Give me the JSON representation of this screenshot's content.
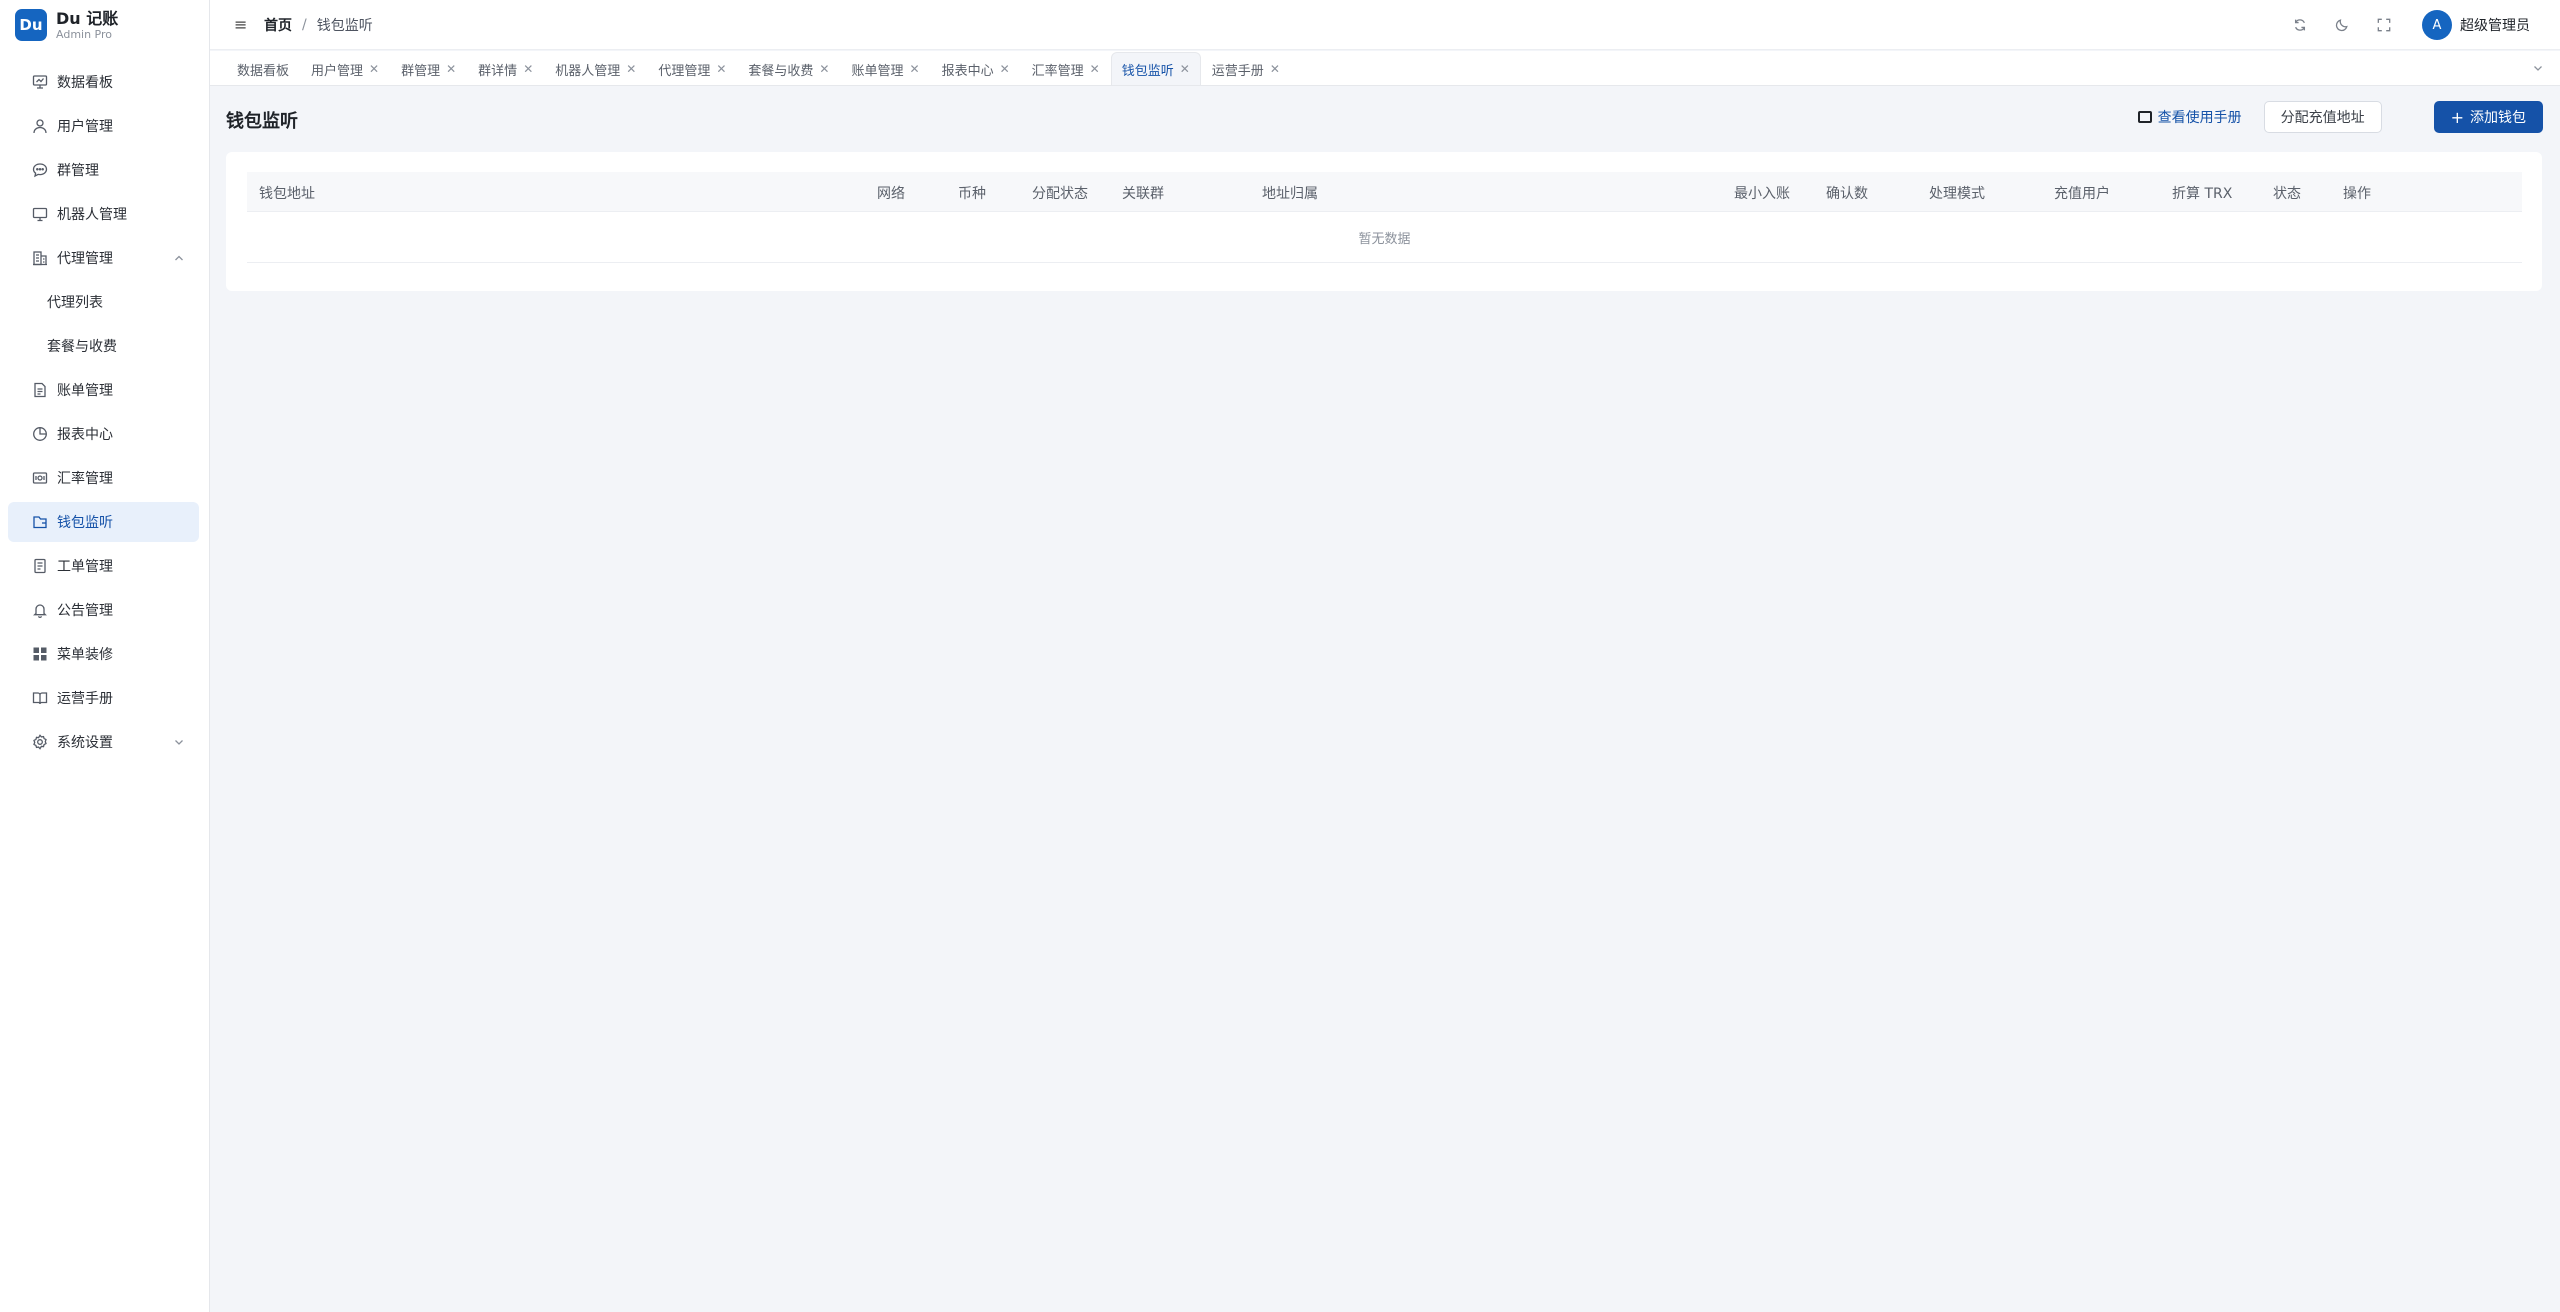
{
  "brand": {
    "logo": "Du",
    "name": "Du 记账",
    "sub": "Admin Pro"
  },
  "sidebar": {
    "items": [
      {
        "label": "数据看板",
        "icon": "dashboard-icon"
      },
      {
        "label": "用户管理",
        "icon": "user-icon"
      },
      {
        "label": "群管理",
        "icon": "chat-icon"
      },
      {
        "label": "机器人管理",
        "icon": "monitor-icon"
      },
      {
        "label": "代理管理",
        "icon": "building-icon",
        "expanded": true
      },
      {
        "label": "代理列表",
        "sub": true
      },
      {
        "label": "套餐与收费",
        "sub": true
      },
      {
        "label": "账单管理",
        "icon": "document-icon"
      },
      {
        "label": "报表中心",
        "icon": "pie-chart-icon"
      },
      {
        "label": "汇率管理",
        "icon": "exchange-icon"
      },
      {
        "label": "钱包监听",
        "icon": "wallet-icon",
        "active": true
      },
      {
        "label": "工单管理",
        "icon": "ticket-icon"
      },
      {
        "label": "公告管理",
        "icon": "bell-icon"
      },
      {
        "label": "菜单装修",
        "icon": "grid-icon"
      },
      {
        "label": "运营手册",
        "icon": "book-icon"
      },
      {
        "label": "系统设置",
        "icon": "gear-icon",
        "expanded": false
      }
    ]
  },
  "header": {
    "breadcrumb_home": "首页",
    "breadcrumb_sep": "/",
    "breadcrumb_current": "钱包监听",
    "avatar_letter": "A",
    "user_name": "超级管理员"
  },
  "tabs": [
    {
      "label": "数据看板",
      "closable": false
    },
    {
      "label": "用户管理",
      "closable": true
    },
    {
      "label": "群管理",
      "closable": true
    },
    {
      "label": "群详情",
      "closable": true
    },
    {
      "label": "机器人管理",
      "closable": true
    },
    {
      "label": "代理管理",
      "closable": true
    },
    {
      "label": "套餐与收费",
      "closable": true
    },
    {
      "label": "账单管理",
      "closable": true
    },
    {
      "label": "报表中心",
      "closable": true
    },
    {
      "label": "汇率管理",
      "closable": true
    },
    {
      "label": "钱包监听",
      "closable": true,
      "active": true
    },
    {
      "label": "运营手册",
      "closable": true
    }
  ],
  "page": {
    "title": "钱包监听",
    "manual_link": "查看使用手册",
    "assign_button": "分配充值地址",
    "add_button": "添加钱包"
  },
  "table": {
    "columns": [
      "钱包地址",
      "网络",
      "币种",
      "分配状态",
      "关联群",
      "地址归属",
      "最小入账",
      "确认数",
      "处理模式",
      "充值用户",
      "折算 TRX",
      "状态",
      "操作"
    ],
    "empty_text": "暂无数据"
  },
  "colors": {
    "primary": "#1552a8",
    "logo": "#1565c0",
    "active_bg": "#e8f0fb"
  }
}
